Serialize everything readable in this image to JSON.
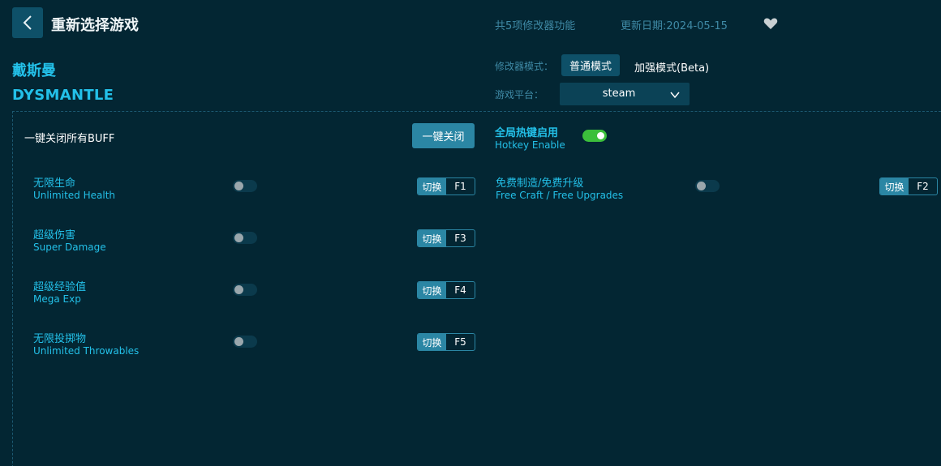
{
  "header": {
    "title": "重新选择游戏",
    "feature_count": "共5项修改器功能",
    "update_date": "更新日期:2024-05-15"
  },
  "game": {
    "name_cn": "戴斯曼",
    "name_en": "DYSMANTLE"
  },
  "mode": {
    "label": "修改器模式：",
    "normal": "普通模式",
    "enhanced": "加强模式(Beta)",
    "selected": "普通模式"
  },
  "platform": {
    "label": "游戏平台：",
    "value": "steam"
  },
  "controls": {
    "all_off_label": "一键关闭所有BUFF",
    "all_off_button": "一键关闭",
    "hotkey_cn": "全局热键启用",
    "hotkey_en": "Hotkey Enable",
    "hotkey_enabled": true
  },
  "cheats": [
    {
      "name_cn": "无限生命",
      "name_en": "Unlimited Health",
      "switch_label": "切换",
      "key": "F1",
      "enabled": false
    },
    {
      "name_cn": "免费制造/免费升级",
      "name_en": "Free Craft / Free Upgrades",
      "switch_label": "切换",
      "key": "F2",
      "enabled": false
    },
    {
      "name_cn": "超级伤害",
      "name_en": "Super Damage",
      "switch_label": "切换",
      "key": "F3",
      "enabled": false
    },
    {
      "name_cn": "超级经验值",
      "name_en": "Mega Exp",
      "switch_label": "切换",
      "key": "F4",
      "enabled": false
    },
    {
      "name_cn": "无限投掷物",
      "name_en": "Unlimited Throwables",
      "switch_label": "切换",
      "key": "F5",
      "enabled": false
    }
  ],
  "colors": {
    "background": "#032633",
    "accent": "#23c0e8",
    "button": "#2b86a4",
    "toggle_on": "#3bbf3b"
  },
  "icons": {
    "back": "chevron-left-icon",
    "favorite": "heart-icon",
    "dropdown": "chevron-down-icon"
  }
}
